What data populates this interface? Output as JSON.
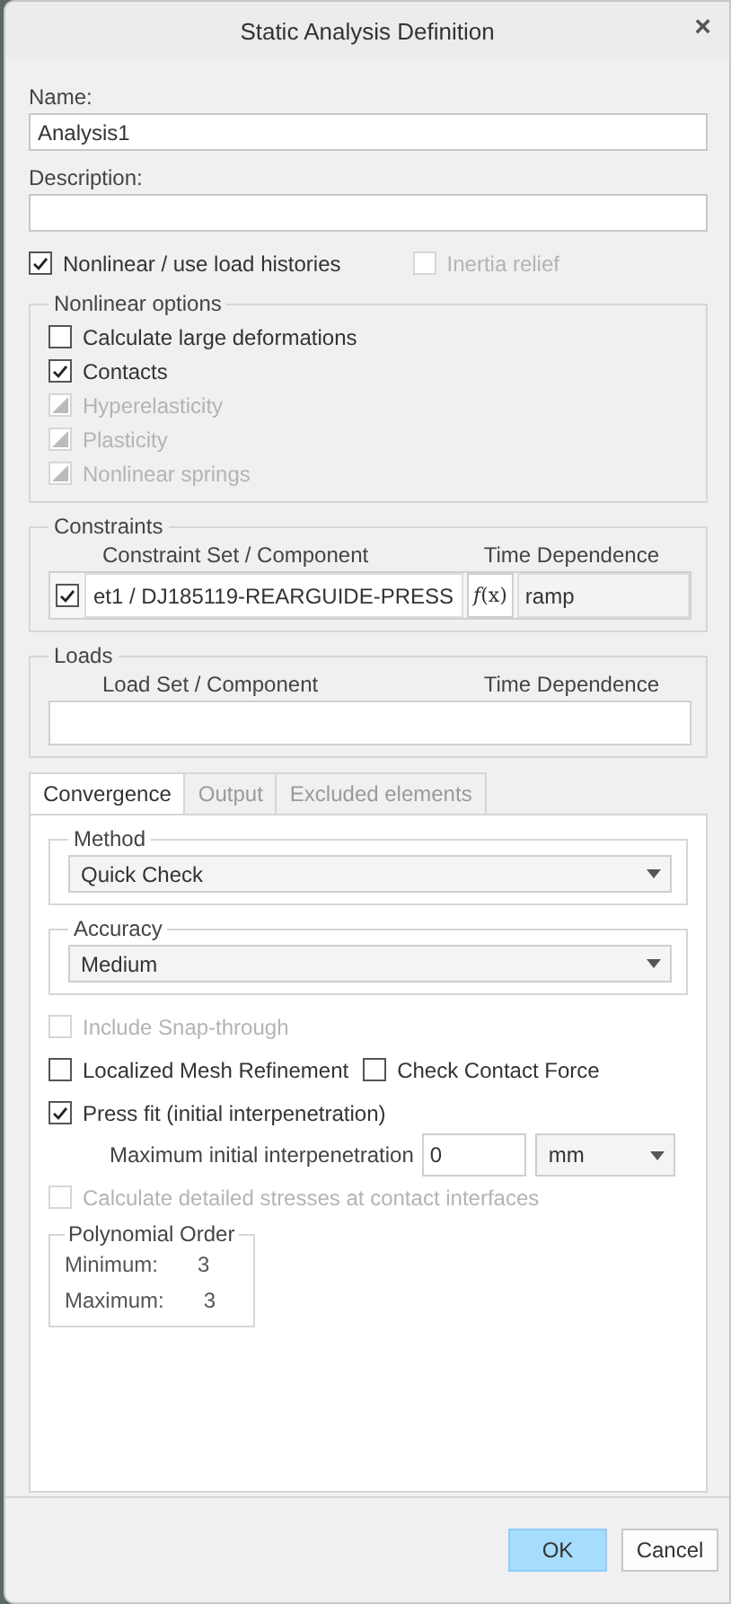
{
  "window": {
    "title": "Static Analysis Definition",
    "close": "×"
  },
  "name": {
    "label": "Name:",
    "value": "Analysis1"
  },
  "description": {
    "label": "Description:"
  },
  "options": [
    {
      "label": "Nonlinear / use load histories",
      "checked": true,
      "disabled": false
    },
    {
      "label": "Inertia relief",
      "checked": false,
      "disabled": true
    }
  ],
  "nonlinear_options": {
    "title": "Nonlinear options",
    "items": [
      {
        "label": "Calculate large deformations",
        "checked": false,
        "disabled": false
      },
      {
        "label": "Contacts",
        "checked": true,
        "disabled": false
      },
      {
        "label": "Hyperelasticity",
        "checked": true,
        "disabled": true
      },
      {
        "label": "Plasticity",
        "checked": true,
        "disabled": true
      },
      {
        "label": "Nonlinear springs",
        "checked": true,
        "disabled": true
      }
    ]
  },
  "constraints": {
    "title": "Constraints",
    "columns": [
      "Constraint Set / Component",
      "Time Dependence"
    ],
    "rows": [
      {
        "checked": true,
        "component": "et1 / DJ185119-REARGUIDE-PRESS",
        "function": "*f*(x)",
        "time": "ramp"
      }
    ]
  },
  "loads": {
    "title": "Loads",
    "columns": [
      "Load Set / Component",
      "Time Dependence"
    ]
  },
  "tabs": [
    {
      "label": "Convergence",
      "selected": true
    },
    {
      "label": "Output",
      "selected": false
    },
    {
      "label": "Excluded elements",
      "selected": false
    }
  ],
  "method": {
    "title": "Method",
    "value": "Quick Check"
  },
  "accuracy": {
    "title": "Accuracy",
    "value": "Medium"
  },
  "convergence_options": [
    {
      "label": "Include Snap-through",
      "checked": false,
      "disabled": true
    },
    {
      "label": "Localized Mesh Refinement",
      "checked": false,
      "disabled": false
    },
    {
      "label": "Check Contact Force",
      "checked": false,
      "disabled": false
    },
    {
      "label": "Press fit (initial interpenetration)",
      "checked": true,
      "disabled": false
    }
  ],
  "interpenetration": {
    "label": "Maximum initial interpenetration",
    "value": "0",
    "unit": "mm"
  },
  "detailed_stresses": {
    "label": "Calculate detailed stresses at contact interfaces",
    "checked": false,
    "disabled": true
  },
  "polynomial_order": {
    "title": "Polynomial Order",
    "rows": [
      {
        "label": "Minimum:",
        "value": "3"
      },
      {
        "label": "Maximum:",
        "value": "3"
      }
    ]
  },
  "buttons": [
    {
      "label": "OK",
      "kind": "primary"
    },
    {
      "label": "Cancel",
      "kind": "secondary"
    }
  ]
}
